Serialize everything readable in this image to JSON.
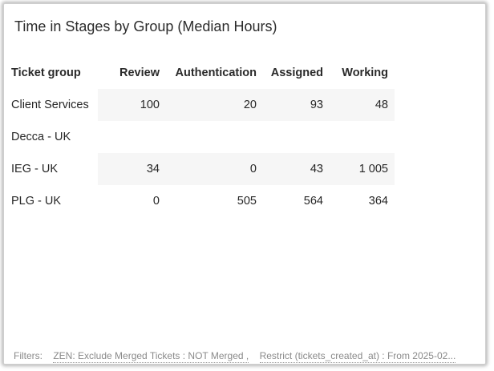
{
  "panel": {
    "title": "Time in Stages by Group (Median Hours)"
  },
  "table": {
    "columns": [
      "Ticket group",
      "Review",
      "Authentication",
      "Assigned",
      "Working"
    ],
    "rows": [
      {
        "group": "Client Services",
        "review": "100",
        "authentication": "20",
        "assigned": "93",
        "working": "48"
      },
      {
        "group": "Decca - UK",
        "review": "",
        "authentication": "",
        "assigned": "",
        "working": ""
      },
      {
        "group": "IEG - UK",
        "review": "34",
        "authentication": "0",
        "assigned": "43",
        "working": "1 005"
      },
      {
        "group": "PLG - UK",
        "review": "0",
        "authentication": "505",
        "assigned": "564",
        "working": "364"
      }
    ]
  },
  "filters": {
    "label": "Filters:",
    "items": [
      "ZEN: Exclude Merged Tickets : NOT Merged ,",
      "Restrict (tickets_created_at) : From 2025-02..."
    ]
  }
}
